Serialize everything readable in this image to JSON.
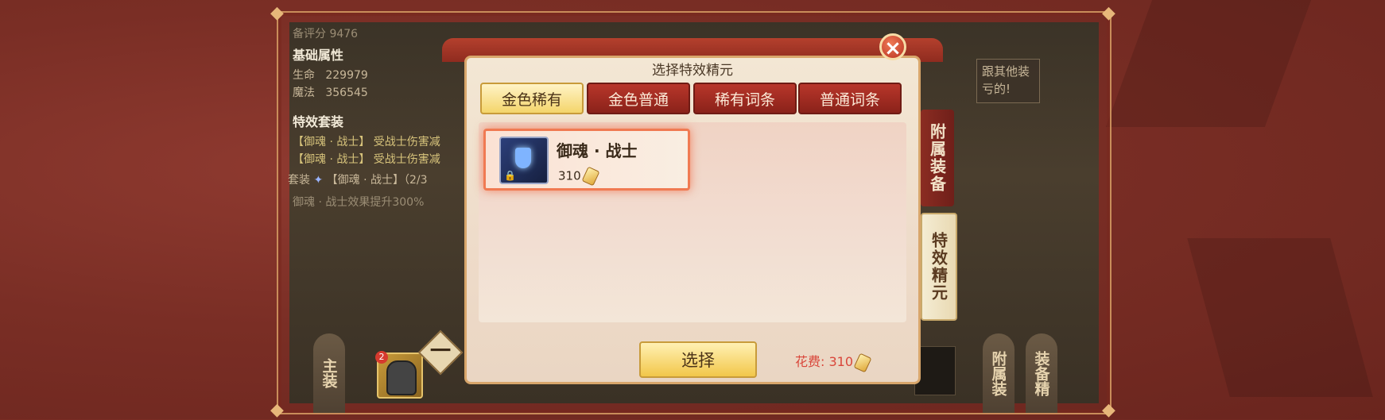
{
  "left_panel": {
    "score_label": "备评分",
    "score_value": "9476",
    "basic_attr_heading": "基础属性",
    "hp_label": "生命",
    "hp_value": "229979",
    "mp_label": "魔法",
    "mp_value": "356545",
    "special_set_heading": "特效套装",
    "effect_line_1": "【御魂 · 战士】 受战士伤害减",
    "effect_line_2": "【御魂 · 战士】 受战士伤害减",
    "set_line_prefix": "套装",
    "set_line_name": "【御魂 · 战士】（2/3",
    "set_line_effect": "御魂 · 战士效果提升300%"
  },
  "right_note": "跟其他装\n亏的!",
  "side_tabs": {
    "attached_equipment": "附属装备",
    "special_essence": "特效精元"
  },
  "bottom_tabs": {
    "main_equipment": "主装",
    "attached_equipment": "附属装",
    "equipment_essence": "装备精",
    "slot_badge": "2",
    "minus_label": "一"
  },
  "dialog": {
    "title": "选择特效精元",
    "tabs": [
      "金色稀有",
      "金色普通",
      "稀有词条",
      "普通词条"
    ],
    "active_tab_index": 0,
    "items": [
      {
        "name": "御魂 · 战士",
        "cost": "310",
        "icon": "shield-swords-icon",
        "locked": true
      }
    ],
    "select_button": "选择",
    "fee_text": "花费: 310",
    "close_symbol": "×"
  },
  "colors": {
    "accent_red": "#b8362a",
    "gold": "#f2c74a",
    "fee_red": "#d9463a"
  }
}
